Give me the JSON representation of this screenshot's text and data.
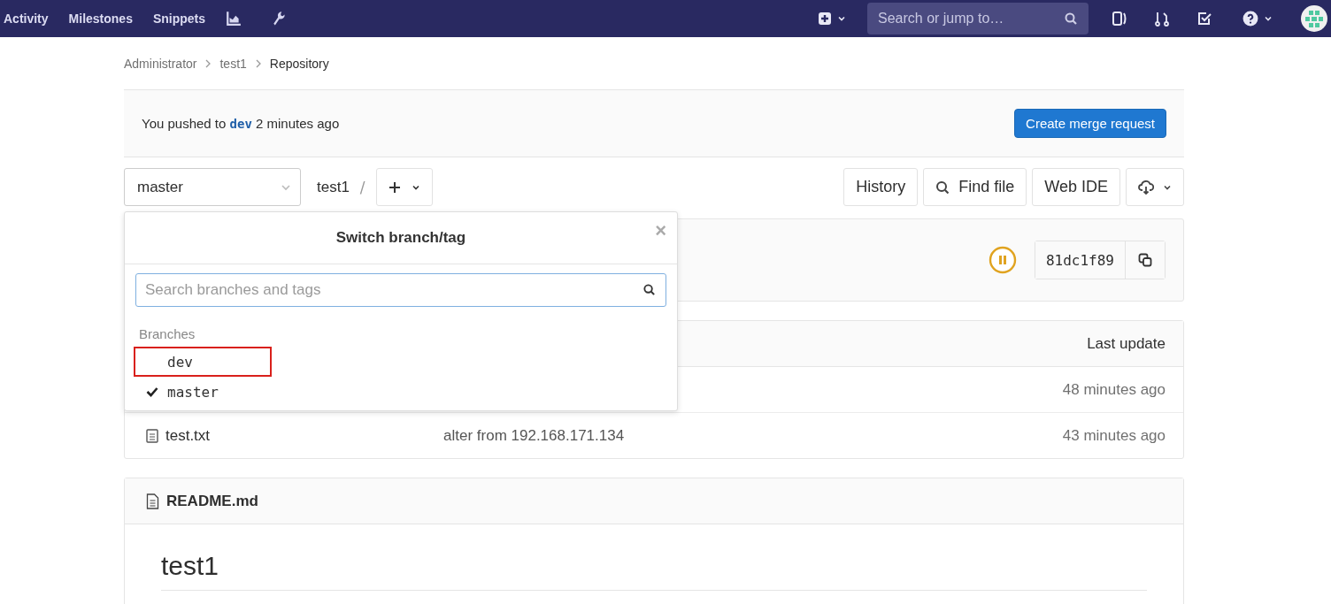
{
  "nav": {
    "links": [
      "Activity",
      "Milestones",
      "Snippets"
    ],
    "search": {
      "placeholder": "Search or jump to…"
    }
  },
  "breadcrumb": [
    "Administrator",
    "test1",
    "Repository"
  ],
  "push_notice": {
    "parts": [
      "You pushed to ",
      "dev",
      " 2 minutes ago"
    ],
    "button": "Create merge request"
  },
  "tree": {
    "branch": "master",
    "path": "test1",
    "separator": "/",
    "buttons": [
      "History",
      "Find file",
      "Web IDE"
    ]
  },
  "commit": {
    "sha": "81dc1f89"
  },
  "files": {
    "header": "Last update",
    "rows": [
      {
        "name": "",
        "message": "",
        "time": "48 minutes ago"
      },
      {
        "name": "test.txt",
        "message": "alter from 192.168.171.134",
        "time": "43 minutes ago"
      }
    ]
  },
  "readme": {
    "file": "README.md",
    "heading": "test1"
  },
  "dropdown": {
    "title": "Switch branch/tag",
    "close": "×",
    "search": {
      "placeholder": "Search branches and tags"
    },
    "section": "Branches",
    "items": [
      {
        "label": "dev",
        "selected": false,
        "annotated": true
      },
      {
        "label": "master",
        "selected": true,
        "annotated": false
      }
    ]
  }
}
